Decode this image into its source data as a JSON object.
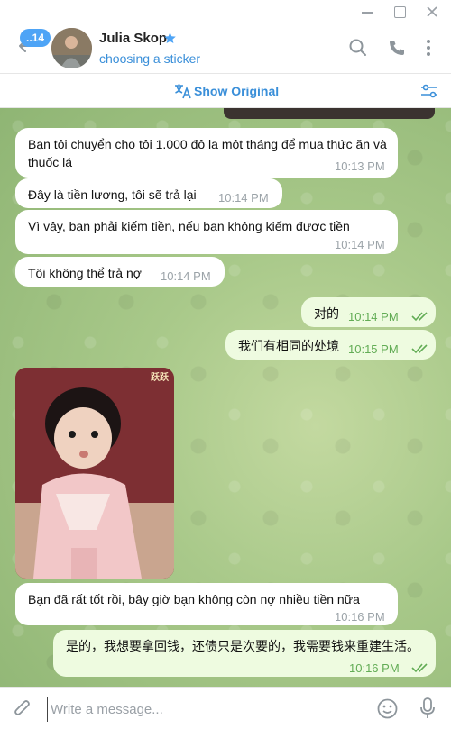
{
  "header": {
    "unread_badge": "..14",
    "name": "Julia Skop",
    "status": "choosing a sticker"
  },
  "translate_bar": {
    "label": "Show Original"
  },
  "messages": [
    {
      "dir": "in",
      "text": "Bạn tôi chuyển cho tôi 1.000 đô la một tháng để mua thức ăn và thuốc lá",
      "time": "10:13 PM"
    },
    {
      "dir": "in",
      "text": "Đây là tiền lương, tôi sẽ trả lại",
      "time": "10:14 PM"
    },
    {
      "dir": "in",
      "text": "Vì vậy, bạn phải kiếm tiền, nếu bạn không kiếm được tiền",
      "time": "10:14 PM"
    },
    {
      "dir": "in",
      "text": "Tôi không thể trả nợ",
      "time": "10:14 PM"
    },
    {
      "dir": "out",
      "text": "对的",
      "time": "10:14 PM"
    },
    {
      "dir": "out",
      "text": "我们有相同的处境",
      "time": "10:15 PM"
    },
    {
      "dir": "in",
      "type": "sticker",
      "sticker_caption": "跃跃"
    },
    {
      "dir": "in",
      "text": "Bạn đã rất tốt rồi, bây giờ bạn không còn nợ nhiều tiền nữa",
      "time": "10:16 PM"
    },
    {
      "dir": "out",
      "text": "是的，我想要拿回钱，还债只是次要的，我需要钱来重建生活。",
      "time": "10:16 PM"
    }
  ],
  "composer": {
    "placeholder": "Write a message..."
  },
  "colors": {
    "accent": "#3a8fd9",
    "badge": "#4ea4f6",
    "outgoing_bubble": "#eefbe0",
    "read_check": "#62ac55"
  }
}
